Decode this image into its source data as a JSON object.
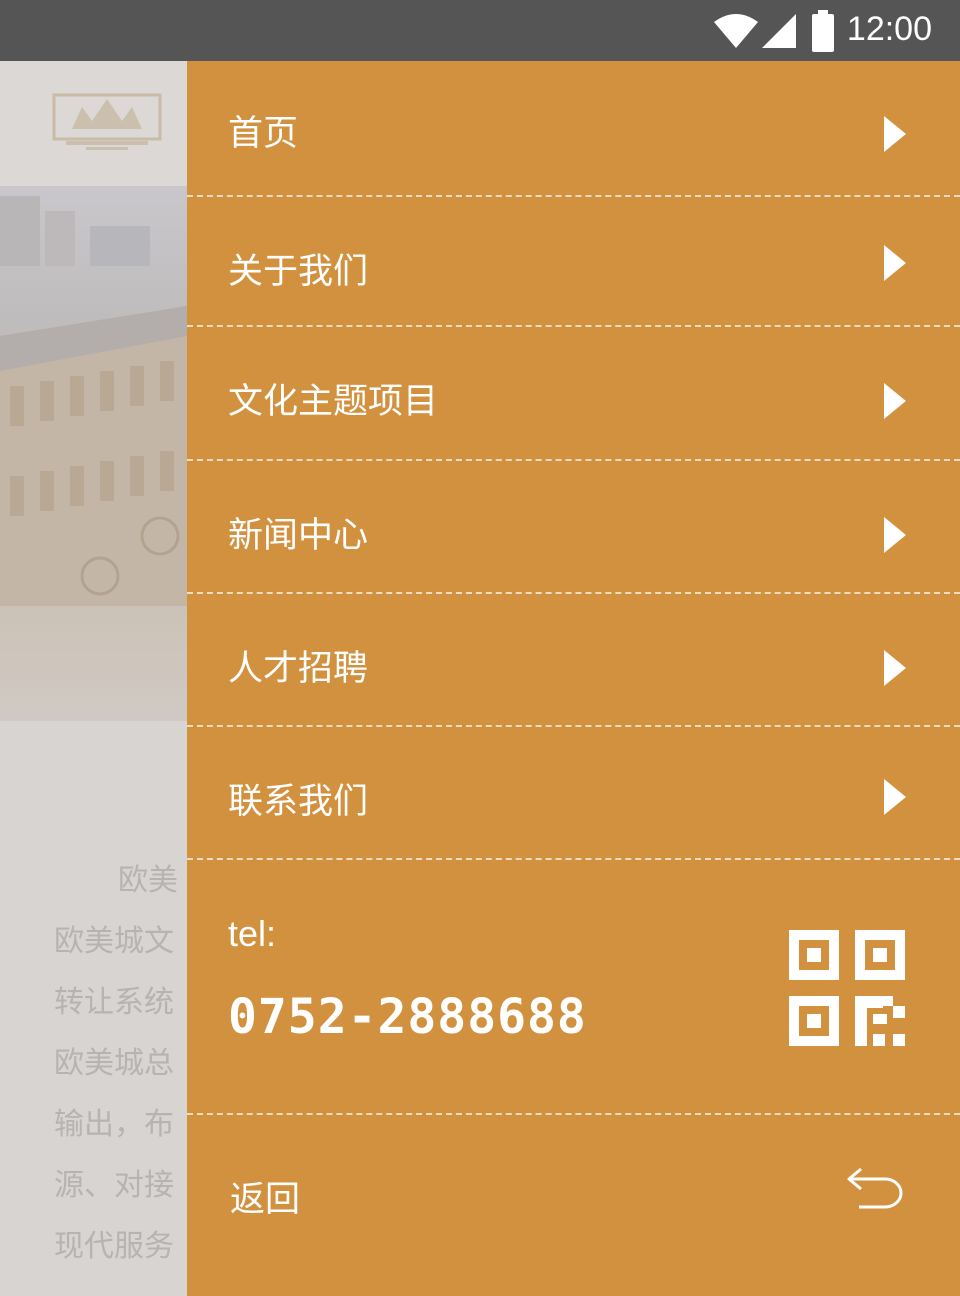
{
  "status_bar": {
    "time": "12:00"
  },
  "background": {
    "paragraph_lines": [
      "欧美",
      "欧美城文",
      "转让系统",
      "欧美城总",
      "输出，布",
      "源、对接",
      "现代服务"
    ]
  },
  "drawer": {
    "menu_items": [
      {
        "label": "首页"
      },
      {
        "label": "关于我们"
      },
      {
        "label": "文化主题项目"
      },
      {
        "label": "新闻中心"
      },
      {
        "label": "人才招聘"
      },
      {
        "label": "联系我们"
      }
    ],
    "contact": {
      "tel_label": "tel:",
      "tel_number": "0752-2888688"
    },
    "back_label": "返回"
  },
  "colors": {
    "drawer_bg": "#d2913f",
    "status_bar_bg": "#555555"
  }
}
